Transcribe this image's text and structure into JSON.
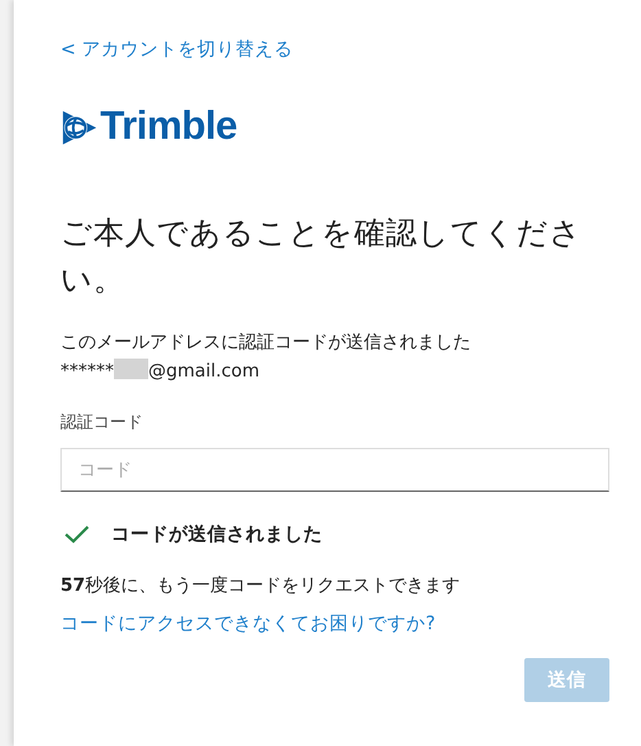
{
  "back_link": "< アカウントを切り替える",
  "logo": {
    "text": "Trimble"
  },
  "heading": "ご本人であることを確認してください。",
  "sent_message": "このメールアドレスに認証コードが送信されました",
  "email": {
    "masked": "******",
    "domain": "@gmail.com"
  },
  "code_field": {
    "label": "認証コード",
    "placeholder": "コード"
  },
  "status": {
    "kind": "success",
    "text": "コードが送信されました"
  },
  "resend_note": "**57**秒後に、もう一度コードをリクエストできます",
  "help_link": "コードにアクセスできなくてお困りですか?",
  "submit_button": {
    "label": "送信",
    "disabled": true
  }
}
